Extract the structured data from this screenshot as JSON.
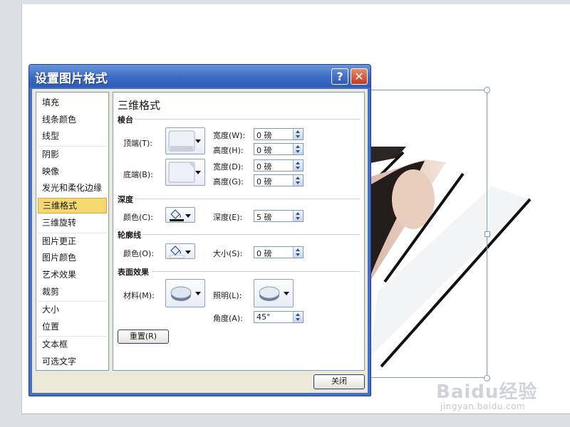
{
  "dialog": {
    "title": "设置图片格式",
    "help_icon": "question-icon",
    "close_icon": "close-x-icon",
    "close_button_label": "关闭",
    "reset_button_label": "重置(R)"
  },
  "nav": {
    "items": [
      "填充",
      "线条颜色",
      "线型",
      "阴影",
      "映像",
      "发光和柔化边缘",
      "三维格式",
      "三维旋转",
      "图片更正",
      "图片颜色",
      "艺术效果",
      "裁剪",
      "大小",
      "位置",
      "文本框",
      "可选文字"
    ],
    "active": "三维格式"
  },
  "panel": {
    "title": "三维格式",
    "bevel": {
      "heading": "棱台",
      "top_label": "顶端(T):",
      "bottom_label": "底端(B):",
      "top_width_label": "宽度(W):",
      "top_width_value": "0 磅",
      "top_height_label": "高度(H):",
      "top_height_value": "0 磅",
      "bottom_width_label": "宽度(D):",
      "bottom_width_value": "0 磅",
      "bottom_height_label": "高度(G):",
      "bottom_height_value": "0 磅"
    },
    "depth": {
      "heading": "深度",
      "color_label": "颜色(C):",
      "depth_label": "深度(E):",
      "depth_value": "5 磅"
    },
    "contour": {
      "heading": "轮廓线",
      "color_label": "颜色(O):",
      "size_label": "大小(S):",
      "size_value": "0 磅"
    },
    "surface": {
      "heading": "表面效果",
      "material_label": "材料(M):",
      "lighting_label": "照明(L):",
      "angle_label": "角度(A):",
      "angle_value": "45°"
    }
  },
  "watermark": {
    "logo": "Baidu经验",
    "url": "jingyan.baidu.com"
  },
  "colors": {
    "titlebar": "#3b6ac4",
    "active_nav": "#f6d873",
    "dialog_bg": "#ece9d8"
  }
}
